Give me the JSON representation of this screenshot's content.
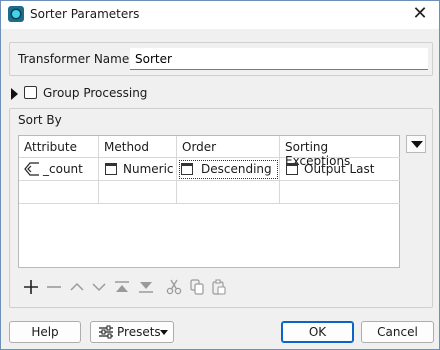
{
  "window": {
    "title": "Sorter Parameters"
  },
  "transformer": {
    "label": "Transformer Name:",
    "value": "Sorter"
  },
  "group_processing": {
    "label": "Group Processing",
    "checked": false
  },
  "sort_by": {
    "title": "Sort By",
    "columns": [
      "Attribute",
      "Method",
      "Order",
      "Sorting Exceptions"
    ],
    "rows": [
      {
        "attribute": "_count",
        "method": "Numeric",
        "order": "Descending",
        "exceptions": "Output Last"
      }
    ]
  },
  "toolbar_icons": [
    "add-icon",
    "remove-icon",
    "move-up-icon",
    "move-down-icon",
    "move-top-icon",
    "move-bottom-icon",
    "cut-icon",
    "copy-icon",
    "paste-icon"
  ],
  "footer": {
    "help": "Help",
    "presets": "Presets",
    "ok": "OK",
    "cancel": "Cancel"
  },
  "colors": {
    "accent": "#0a64c8",
    "app_icon": "#1c6c8c"
  }
}
